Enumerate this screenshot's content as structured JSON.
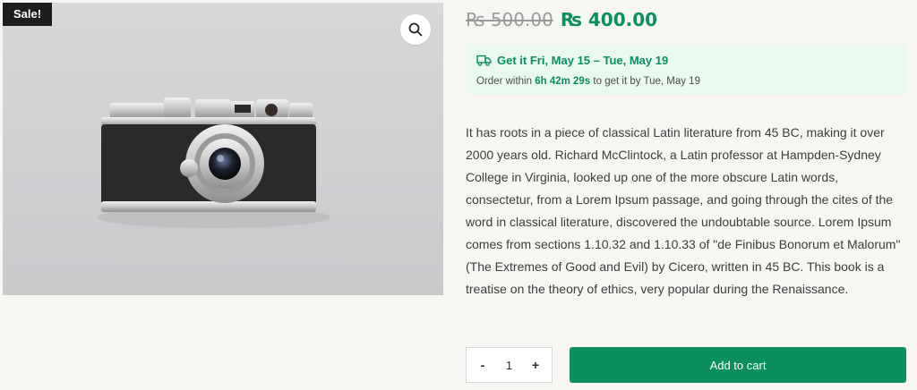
{
  "product": {
    "sale_badge": "Sale!",
    "image_alt": "Vintage rangefinder camera",
    "zoom_icon": "magnifier-icon",
    "price_old": "₨ 500.00",
    "price_new": "₨ 400.00",
    "colors": {
      "accent": "#0b8f5d",
      "badge_bg": "#1d1d1f"
    }
  },
  "delivery": {
    "icon": "truck-icon",
    "title": "Get it Fri, May 15 – Tue, May 19",
    "order_prefix": "Order within",
    "countdown": "6h 42m 29s",
    "order_suffix": "to get it by Tue, May 19"
  },
  "description": "It has roots in a piece of classical Latin literature from 45 BC, making it over 2000 years old. Richard McClintock, a Latin professor at Hampden-Sydney College in Virginia, looked up one of the more obscure Latin words, consectetur, from a Lorem Ipsum passage, and going through the cites of the word in classical literature, discovered the undoubtable source. Lorem Ipsum comes from sections 1.10.32 and 1.10.33 of \"de Finibus Bonorum et Malorum\" (The Extremes of Good and Evil) by Cicero, written in 45 BC. This book is a treatise on the theory of ethics, very popular during the Renaissance.",
  "cart": {
    "minus": "-",
    "quantity": "1",
    "plus": "+",
    "add_label": "Add to cart"
  }
}
